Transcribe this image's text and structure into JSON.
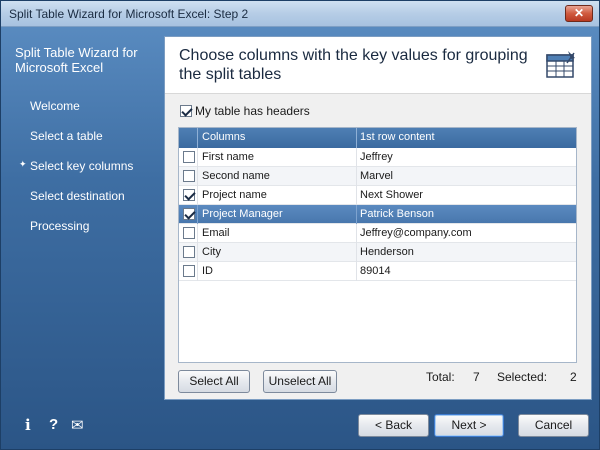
{
  "window": {
    "title": "Split Table Wizard for Microsoft Excel: Step 2",
    "close_glyph": "✕"
  },
  "sidebar": {
    "title": "Split Table Wizard for Microsoft Excel",
    "items": [
      {
        "label": "Welcome",
        "active": false
      },
      {
        "label": "Select a table",
        "active": false
      },
      {
        "label": "Select key columns",
        "active": true
      },
      {
        "label": "Select destination",
        "active": false
      },
      {
        "label": "Processing",
        "active": false
      }
    ],
    "icons": [
      {
        "name": "info-icon",
        "glyph": "i"
      },
      {
        "name": "help-icon",
        "glyph": "?"
      },
      {
        "name": "mail-icon",
        "glyph": "✉"
      }
    ]
  },
  "content": {
    "heading": "Choose columns with the key values for grouping the split tables",
    "headers_option": {
      "label": "My table has headers",
      "checked": true
    },
    "table": {
      "columns": [
        "Columns",
        "1st row content"
      ],
      "rows": [
        {
          "checked": false,
          "column": "First name",
          "value": "Jeffrey",
          "selected": false
        },
        {
          "checked": false,
          "column": "Second name",
          "value": "Marvel",
          "selected": false
        },
        {
          "checked": true,
          "column": "Project name",
          "value": "Next Shower",
          "selected": false
        },
        {
          "checked": true,
          "column": "Project Manager",
          "value": "Patrick Benson",
          "selected": true
        },
        {
          "checked": false,
          "column": "Email",
          "value": "Jeffrey@company.com",
          "selected": false
        },
        {
          "checked": false,
          "column": "City",
          "value": "Henderson",
          "selected": false
        },
        {
          "checked": false,
          "column": "ID",
          "value": "89014",
          "selected": false
        }
      ]
    },
    "select_all_label": "Select All",
    "unselect_all_label": "Unselect All",
    "total_label": "Total:",
    "total_value": "7",
    "selected_label": "Selected:",
    "selected_value": "2"
  },
  "footer": {
    "back_label": "< Back",
    "next_label": "Next >",
    "cancel_label": "Cancel"
  },
  "colors": {
    "accent": "#3b6aa0",
    "selection": "#4877ad",
    "window_bg": "#3e6ea3"
  }
}
